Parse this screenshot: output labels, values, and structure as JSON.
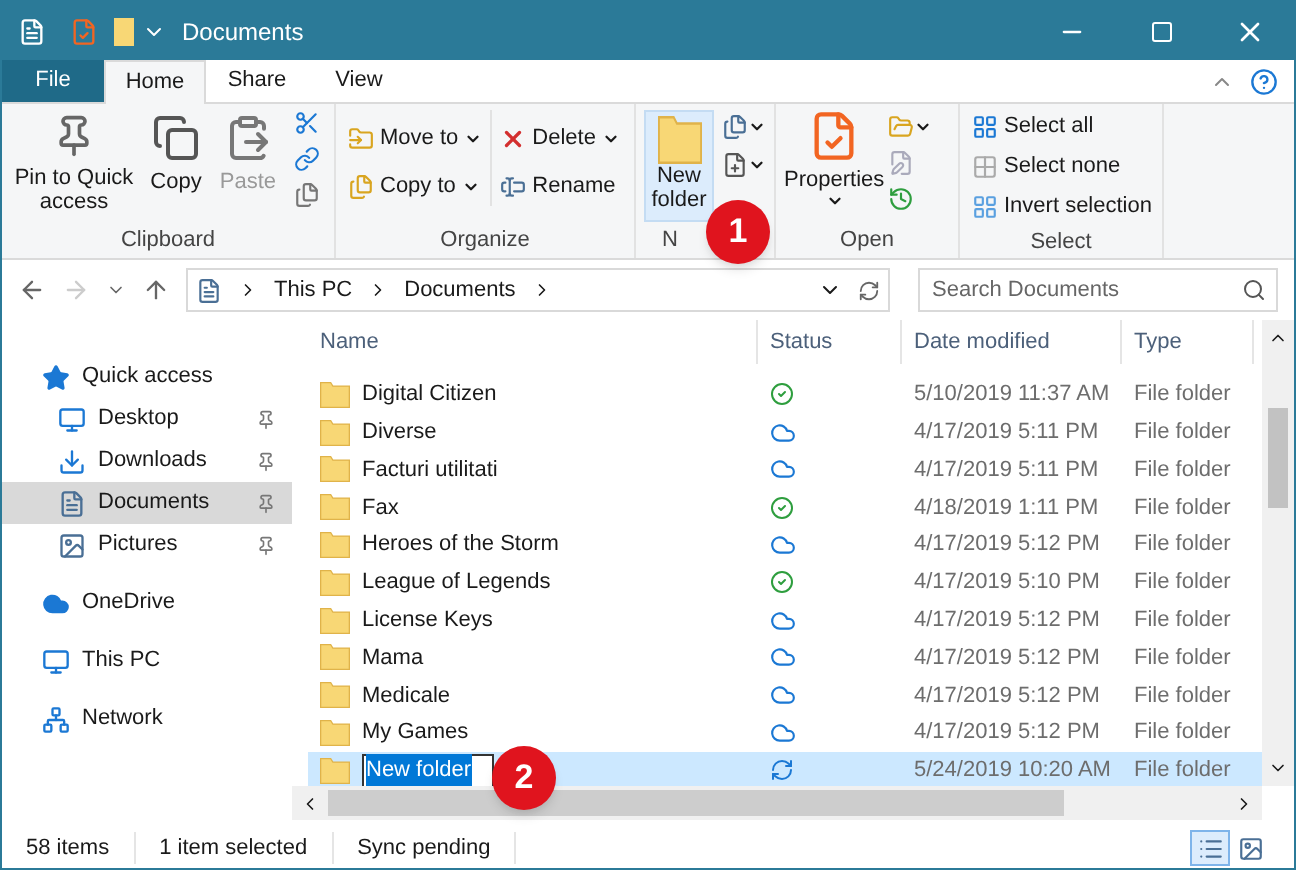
{
  "window": {
    "title": "Documents"
  },
  "ribbon_tabs": [
    {
      "label": "File",
      "kind": "file",
      "selected": false
    },
    {
      "label": "Home",
      "kind": "tab",
      "selected": true
    },
    {
      "label": "Share",
      "kind": "tab",
      "selected": false
    },
    {
      "label": "View",
      "kind": "tab",
      "selected": false
    }
  ],
  "clipboard": {
    "label": "Clipboard",
    "pin": "Pin to Quick access",
    "copy": "Copy",
    "paste": "Paste"
  },
  "organize": {
    "label": "Organize",
    "move_to": "Move to",
    "copy_to": "Copy to",
    "delete": "Delete",
    "rename": "Rename"
  },
  "new": {
    "label": "N",
    "new_folder": "New folder"
  },
  "open": {
    "label": "Open",
    "properties": "Properties"
  },
  "select": {
    "label": "Select",
    "items": [
      "Select all",
      "Select none",
      "Invert selection"
    ]
  },
  "callouts": [
    "1",
    "2"
  ],
  "address": {
    "crumbs": [
      "This PC",
      "Documents"
    ]
  },
  "search": {
    "placeholder": "Search Documents"
  },
  "sidebar": {
    "items": [
      {
        "label": "Quick access",
        "children": [
          {
            "label": "Desktop",
            "pinned": true,
            "selected": false
          },
          {
            "label": "Downloads",
            "pinned": true,
            "selected": false
          },
          {
            "label": "Documents",
            "pinned": true,
            "selected": true
          },
          {
            "label": "Pictures",
            "pinned": true,
            "selected": false
          }
        ]
      },
      {
        "label": "OneDrive"
      },
      {
        "label": "This PC"
      },
      {
        "label": "Network"
      }
    ]
  },
  "table": {
    "columns": [
      "Name",
      "Status",
      "Date modified",
      "Type"
    ],
    "rows": [
      {
        "name": "Digital Citizen",
        "kind": "synced",
        "date": "5/10/2019 11:37 AM",
        "type": "File folder",
        "selected": false,
        "editing": false
      },
      {
        "name": "Diverse",
        "kind": "cloud",
        "date": "4/17/2019 5:11 PM",
        "type": "File folder",
        "selected": false,
        "editing": false
      },
      {
        "name": "Facturi utilitati",
        "kind": "cloud",
        "date": "4/17/2019 5:11 PM",
        "type": "File folder",
        "selected": false,
        "editing": false
      },
      {
        "name": "Fax",
        "kind": "synced",
        "date": "4/18/2019 1:11 PM",
        "type": "File folder",
        "selected": false,
        "editing": false
      },
      {
        "name": "Heroes of the Storm",
        "kind": "cloud",
        "date": "4/17/2019 5:12 PM",
        "type": "File folder",
        "selected": false,
        "editing": false
      },
      {
        "name": "League of Legends",
        "kind": "synced",
        "date": "4/17/2019 5:10 PM",
        "type": "File folder",
        "selected": false,
        "editing": false
      },
      {
        "name": "License Keys",
        "kind": "cloud",
        "date": "4/17/2019 5:12 PM",
        "type": "File folder",
        "selected": false,
        "editing": false
      },
      {
        "name": "Mama",
        "kind": "cloud",
        "date": "4/17/2019 5:12 PM",
        "type": "File folder",
        "selected": false,
        "editing": false
      },
      {
        "name": "Medicale",
        "kind": "cloud",
        "date": "4/17/2019 5:12 PM",
        "type": "File folder",
        "selected": false,
        "editing": false
      },
      {
        "name": "My Games",
        "kind": "cloud",
        "date": "4/17/2019 5:12 PM",
        "type": "File folder",
        "selected": false,
        "editing": false
      },
      {
        "name": "New folder",
        "kind": "syncing",
        "date": "5/24/2019 10:20 AM",
        "type": "File folder",
        "selected": true,
        "editing": true
      }
    ]
  },
  "status_bar": {
    "texts": [
      "58 items",
      "1 item selected",
      "Sync pending"
    ],
    "views": [
      {
        "kind": "details",
        "selected": true
      },
      {
        "kind": "large",
        "selected": false
      }
    ]
  }
}
